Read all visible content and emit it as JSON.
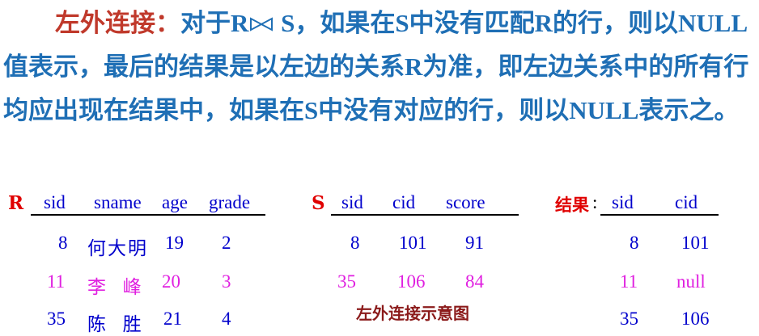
{
  "paragraph": {
    "term": "左外连接：",
    "seg1": "对于",
    "r": "R",
    "s": " S",
    "seg2": "，如果在",
    "s2": "S",
    "seg3": "中没有匹配",
    "r2": "R",
    "seg4": "的行，则以",
    "null1": "NULL",
    "seg5": "值表示，最后的结果是以左边的关系",
    "r3": "R",
    "seg6": "为准，即左边关系中的所有行均应出现在结果中，如果在",
    "s3": "S",
    "seg7": "中没有对应的行，则以",
    "null2": "NULL",
    "seg8": "表示之。"
  },
  "table_r": {
    "label": "R",
    "headers": [
      "sid",
      "sname",
      "age",
      "grade"
    ],
    "rows": [
      {
        "sid": "8",
        "sname": "何大明",
        "age": "19",
        "grade": "2",
        "color": "#0000cc"
      },
      {
        "sid": "11",
        "sname": "李  峰",
        "age": "20",
        "grade": "3",
        "color": "#e020e0"
      },
      {
        "sid": "35",
        "sname": "陈  胜",
        "age": "21",
        "grade": "4",
        "color": "#0000cc"
      }
    ]
  },
  "table_s": {
    "label": "S",
    "headers": [
      "sid",
      "cid",
      "score"
    ],
    "rows": [
      {
        "sid": "8",
        "cid": "101",
        "score": "91",
        "color": "#0000cc"
      },
      {
        "sid": "35",
        "cid": "106",
        "score": "84",
        "color": "#e020e0"
      }
    ]
  },
  "table_result": {
    "label": "结果",
    "colon": ":",
    "headers": [
      "sid",
      "cid"
    ],
    "rows": [
      {
        "sid": "8",
        "cid": "101",
        "color": "#0000cc"
      },
      {
        "sid": "11",
        "cid": "null",
        "color": "#e020e0"
      },
      {
        "sid": "35",
        "cid": "106",
        "color": "#0000cc"
      }
    ]
  },
  "caption": "左外连接示意图",
  "colors": {
    "text": "#1f6fb5",
    "term": "#c0392b",
    "label": "#e00000",
    "blue": "#0000cc",
    "magenta": "#e020e0",
    "caption": "#8b1a1a"
  },
  "icons": {
    "join_symbol": "left-outer-join-icon"
  }
}
